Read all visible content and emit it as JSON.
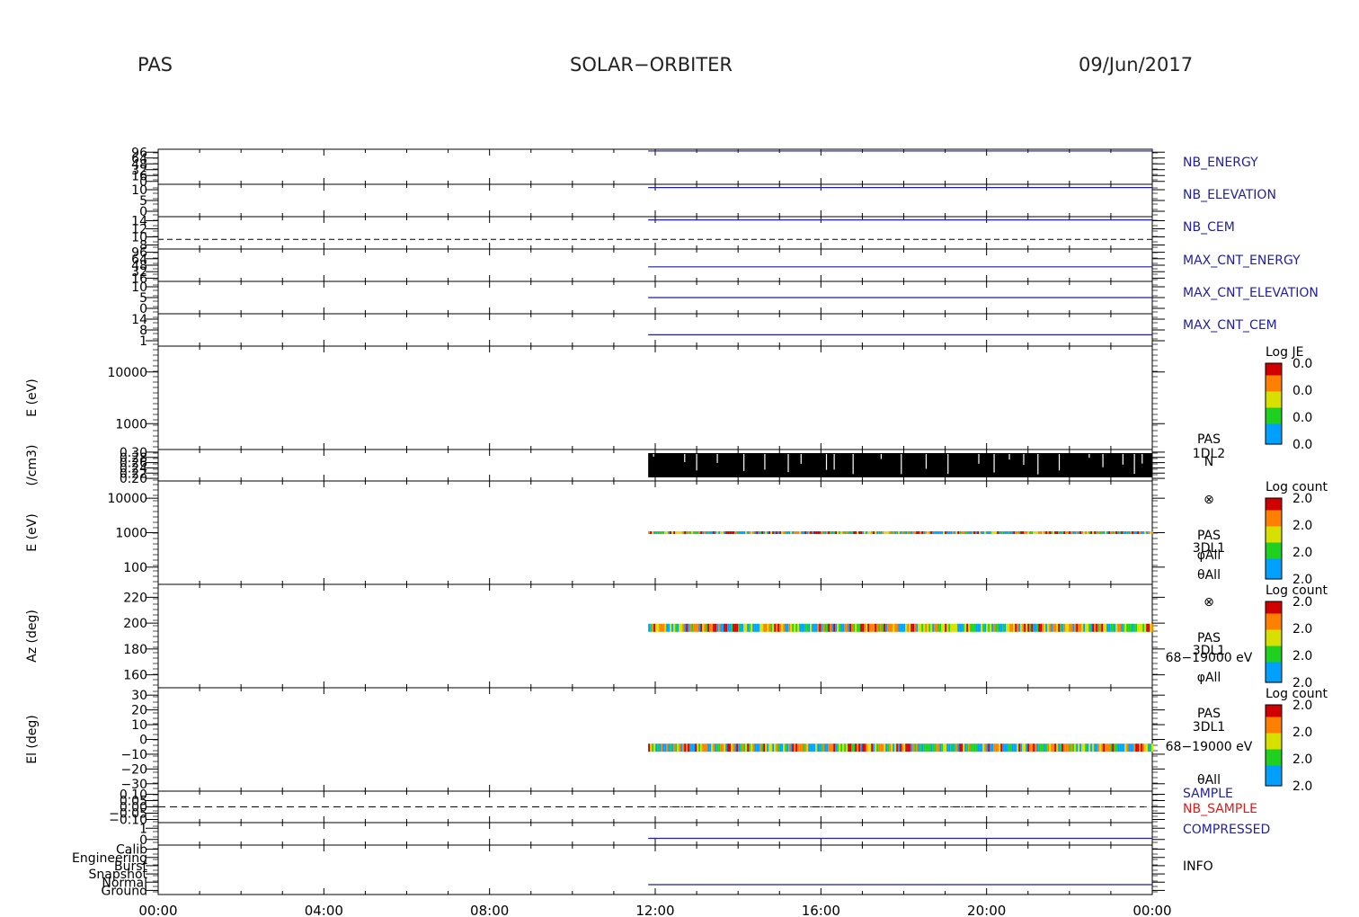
{
  "header": {
    "left": "PAS",
    "center": "SOLAR−ORBITER",
    "right": "09/Jun/2017"
  },
  "colors": {
    "blue": "#1f1fa0",
    "red": "#d42020",
    "ink": "#000000"
  },
  "chart_data": {
    "type": "line",
    "time_axis": {
      "ticks": [
        "00:00",
        "04:00",
        "08:00",
        "12:00",
        "16:00",
        "20:00",
        "00:00"
      ],
      "range_hours": [
        0,
        24
      ],
      "data_start_hour": 11.83
    },
    "panels": [
      {
        "id": "nb-energy",
        "label": "NB_ENERGY",
        "label_color": "#1f1fa0",
        "tick_labels": [
          "96",
          "64",
          "48",
          "32",
          "16",
          "0"
        ],
        "trace": "line",
        "value_level": 0.95
      },
      {
        "id": "nb-elevation",
        "label": "NB_ELEVATION",
        "label_color": "#1f1fa0",
        "tick_labels": [
          "10",
          "5",
          "0"
        ],
        "trace": "line",
        "value_level": 0.9
      },
      {
        "id": "nb-cem",
        "label": "NB_CEM",
        "label_color": "#1f1fa0",
        "tick_labels": [
          "14",
          "12",
          "10",
          "8"
        ],
        "trace": "line",
        "value_level": 0.9,
        "dashed_level": 0.3
      },
      {
        "id": "max-cnt-energy",
        "label": "MAX_CNT_ENERGY",
        "label_color": "#1f1fa0",
        "tick_labels": [
          "96",
          "64",
          "48",
          "32",
          "16"
        ],
        "trace": "line",
        "value_level": 0.45
      },
      {
        "id": "max-cnt-elevation",
        "label": "MAX_CNT_ELEVATION",
        "label_color": "#1f1fa0",
        "tick_labels": [
          "10",
          "5",
          "0"
        ],
        "trace": "line",
        "value_level": 0.5
      },
      {
        "id": "max-cnt-cem",
        "label": "MAX_CNT_CEM",
        "label_color": "#1f1fa0",
        "tick_labels": [
          "14",
          "8",
          "1"
        ],
        "trace": "line",
        "value_level": 0.35
      },
      {
        "id": "je-spectrogram",
        "ylabel": "E (eV)",
        "tick_labels": [
          "10000",
          "1000"
        ],
        "trace": "empty",
        "colorbar": {
          "title": "Log JE",
          "labels": [
            "0.0",
            "0.0",
            "0.0",
            "0.0"
          ]
        }
      },
      {
        "id": "density",
        "ylabel": "(/cm3)",
        "tick_labels": [
          "0.30",
          "0.28",
          "0.26",
          "0.24",
          "0.22",
          "0.20"
        ],
        "trace": "dense_noise",
        "side_labels": [
          "PAS",
          "1DL2",
          "N"
        ]
      },
      {
        "id": "energy-spectrogram",
        "ylabel": "E (eV)",
        "tick_labels": [
          "10000",
          "1000",
          "100"
        ],
        "trace": "band",
        "band_level": 0.5,
        "side_labels": [
          "⊗",
          "PAS",
          "3DL1",
          "φAll",
          "θAll"
        ],
        "colorbar": {
          "title": "Log count",
          "labels": [
            "2.0",
            "2.0",
            "2.0",
            "2.0"
          ]
        }
      },
      {
        "id": "azimuth-spectrogram",
        "ylabel": "Az (deg)",
        "tick_labels": [
          "220",
          "200",
          "180",
          "160"
        ],
        "trace": "band",
        "band_level": 0.58,
        "side_labels": [
          "⊗",
          "PAS",
          "3DL1",
          "68−19000 eV",
          "φAll"
        ],
        "colorbar": {
          "title": "Log count",
          "labels": [
            "2.0",
            "2.0",
            "2.0",
            "2.0"
          ]
        }
      },
      {
        "id": "elevation-spectrogram",
        "ylabel": "El (deg)",
        "tick_labels": [
          "30",
          "20",
          "10",
          "0",
          "−10",
          "−20",
          "−30"
        ],
        "trace": "band",
        "band_level": 0.42,
        "side_labels": [
          "PAS",
          "3DL1",
          "68−19000 eV",
          "θAll"
        ],
        "colorbar": {
          "title": "Log count",
          "labels": [
            "2.0",
            "2.0",
            "2.0",
            "2.0"
          ]
        }
      },
      {
        "id": "sample",
        "tick_labels": [
          "0.10",
          "0.05",
          "0.00",
          "−0.05",
          "−0.10"
        ],
        "trace": "dashed",
        "side_labels": [
          "SAMPLE",
          "NB_SAMPLE"
        ],
        "side_colors": [
          "#1f1fa0",
          "#d42020"
        ]
      },
      {
        "id": "compressed",
        "label": "COMPRESSED",
        "label_color": "#1f1fa0",
        "tick_labels": [
          "1",
          "0"
        ],
        "trace": "line",
        "value_level": 0.3
      },
      {
        "id": "info",
        "label": "INFO",
        "label_color": "#000000",
        "tick_labels": [
          "Calib",
          "Engineering",
          "Burst",
          "Snapshot",
          "Normal",
          "Ground"
        ],
        "trace": "line",
        "value_level": 0.2
      }
    ]
  }
}
